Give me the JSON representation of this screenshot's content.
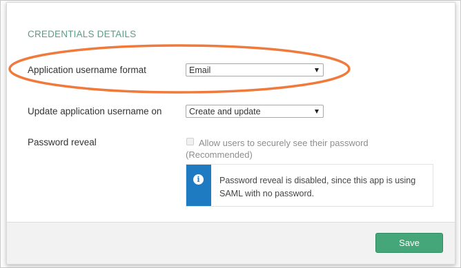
{
  "section": {
    "title": "CREDENTIALS DETAILS"
  },
  "fields": {
    "username_format": {
      "label": "Application username format",
      "value": "Email"
    },
    "update_on": {
      "label": "Update application username on",
      "value": "Create and update"
    },
    "password_reveal": {
      "label": "Password reveal",
      "checkbox_label": "Allow users to securely see their password (Recommended)",
      "checked": false
    }
  },
  "info": {
    "icon": "info-icon",
    "text": "Password reveal is disabled, since this app is using SAML with no password."
  },
  "footer": {
    "save_label": "Save"
  },
  "colors": {
    "accent": "#5a9e86",
    "info_blue": "#1f7bc1",
    "save_green": "#45a779",
    "highlight_orange": "#f07a3c"
  }
}
